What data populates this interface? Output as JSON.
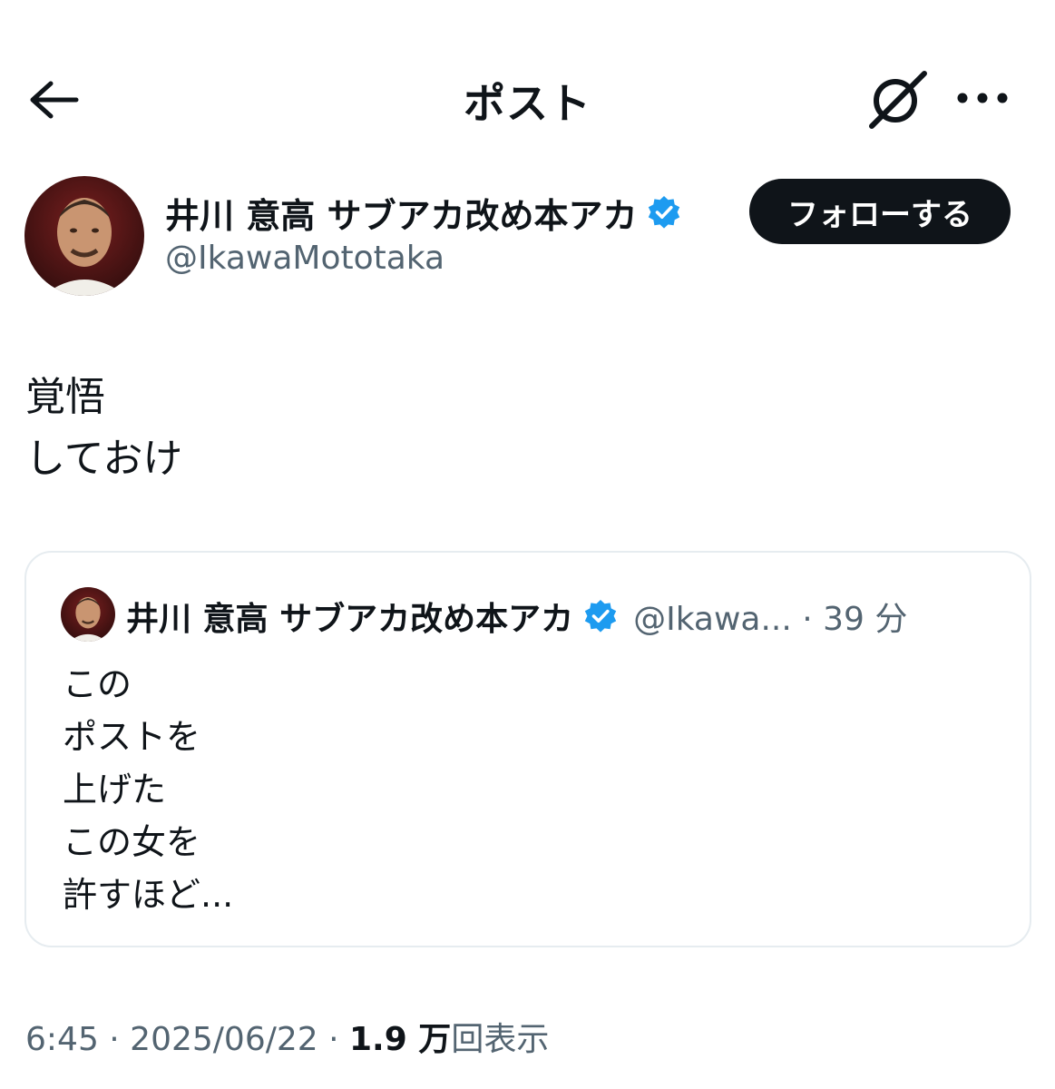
{
  "header": {
    "title": "ポスト",
    "back_icon": "arrow-left-icon",
    "grok_icon": "grok-icon",
    "more_icon": "more-horizontal-icon"
  },
  "author": {
    "name": "井川 意高 サブアカ改め本アカ",
    "handle": "@IkawaMototaka",
    "verified": true,
    "follow_label": "フォローする"
  },
  "post": {
    "text": "覚悟\nしておけ"
  },
  "quote": {
    "name": "井川 意高 サブアカ改め本アカ",
    "handle_time": "@Ikawa... · 39 分",
    "verified": true,
    "text": "この\nポストを\n上げた\nこの女を\n許すほど..."
  },
  "meta": {
    "time_date": "6:45 · 2025/06/22 · ",
    "views_number": "1.9 万",
    "views_label": "回表示"
  },
  "colors": {
    "text": "#0f1419",
    "secondary": "#536471",
    "verified_blue": "#1d9bf0",
    "border": "#e6ecf0"
  }
}
